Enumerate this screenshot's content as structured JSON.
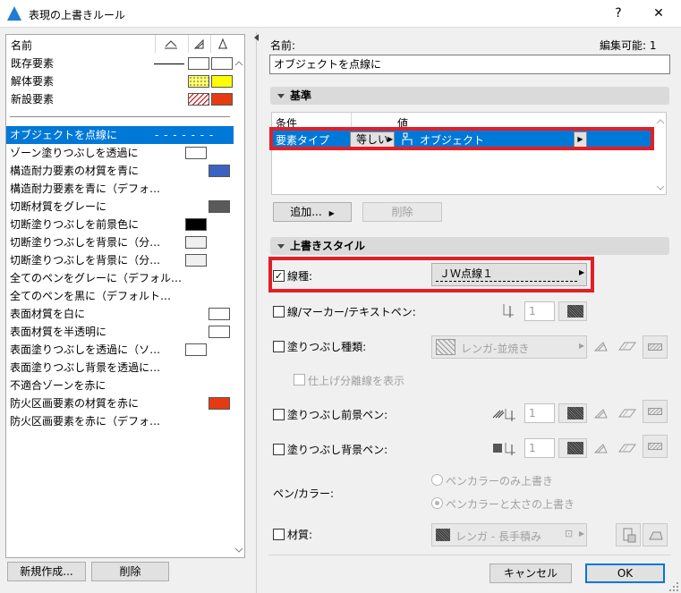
{
  "window": {
    "title": "表現の上書きルール",
    "help": "?",
    "close": "✕"
  },
  "left": {
    "header_name": "名前",
    "categories": [
      {
        "label": "既存要素",
        "fill": "#ffffff",
        "fill2": "#ffffff"
      },
      {
        "label": "解体要素",
        "fill": "dotted-yellow",
        "fill2": "#ffff00"
      },
      {
        "label": "新設要素",
        "fill": "hatched-red",
        "fill2": "#e63b12"
      }
    ],
    "rules": [
      {
        "label": "オブジェクトを点線に",
        "selected": true,
        "marker": "- - - - - - -"
      },
      {
        "label": "ゾーン塗りつぶしを透過に",
        "swatch": "#ffffff"
      },
      {
        "label": "構造耐力要素の材質を青に",
        "swatch": "#3a62c4"
      },
      {
        "label": "構造耐力要素を青に（デフォ…"
      },
      {
        "label": "切断材質をグレーに",
        "swatch": "#5a5a5a"
      },
      {
        "label": "切断塗りつぶしを前景色に",
        "swatch": "#000000"
      },
      {
        "label": "切断塗りつぶしを背景に（分…",
        "swatch": "#f0f0f0"
      },
      {
        "label": "切断塗りつぶしを背景に（分…",
        "swatch": "#f0f0f0"
      },
      {
        "label": "全てのペンをグレーに（デフォル…"
      },
      {
        "label": "全てのペンを黒に（デフォルト…"
      },
      {
        "label": "表面材質を白に",
        "swatch": "#ffffff"
      },
      {
        "label": "表面材質を半透明に",
        "swatch": "#ffffff"
      },
      {
        "label": "表面塗りつぶしを透過に（ソ…",
        "swatch": "#ffffff"
      },
      {
        "label": "表面塗りつぶし背景を透過に…"
      },
      {
        "label": "不適合ゾーンを赤に"
      },
      {
        "label": "防火区画要素の材質を赤に",
        "swatch": "#e63b12"
      },
      {
        "label": "防火区画要素を赤に（デフォ…"
      }
    ],
    "new_button": "新規作成...",
    "delete_button": "削除"
  },
  "right": {
    "name_label": "名前:",
    "editable_label": "編集可能: 1",
    "name_value": "オブジェクトを点線に",
    "criteria": {
      "title": "基準",
      "col_condition": "条件",
      "col_value": "値",
      "row_element": "要素タイプ",
      "row_operator": "等しい",
      "row_value": "オブジェクト",
      "add_button": "追加...",
      "delete_button": "削除"
    },
    "style": {
      "title": "上書きスタイル",
      "linetype_label": "線種:",
      "linetype_value": "ＪＷ点線１",
      "line_pen_label": "線/マーカー/テキストペン:",
      "fill_type_label": "塗りつぶし種類:",
      "fill_type_value": "レンガ-並焼き",
      "finish_sep_label": "仕上げ分離線を表示",
      "fill_fg_label": "塗りつぶし前景ペン:",
      "fill_bg_label": "塗りつぶし背景ペン:",
      "pen_color_label": "ペン/カラー:",
      "radio_color_only": "ペンカラーのみ上書き",
      "radio_color_weight": "ペンカラーと太さの上書き",
      "material_label": "材質:",
      "material_value": "レンガ - 長手積み",
      "pen_value": "1"
    },
    "cancel_button": "キャンセル",
    "ok_button": "OK"
  }
}
